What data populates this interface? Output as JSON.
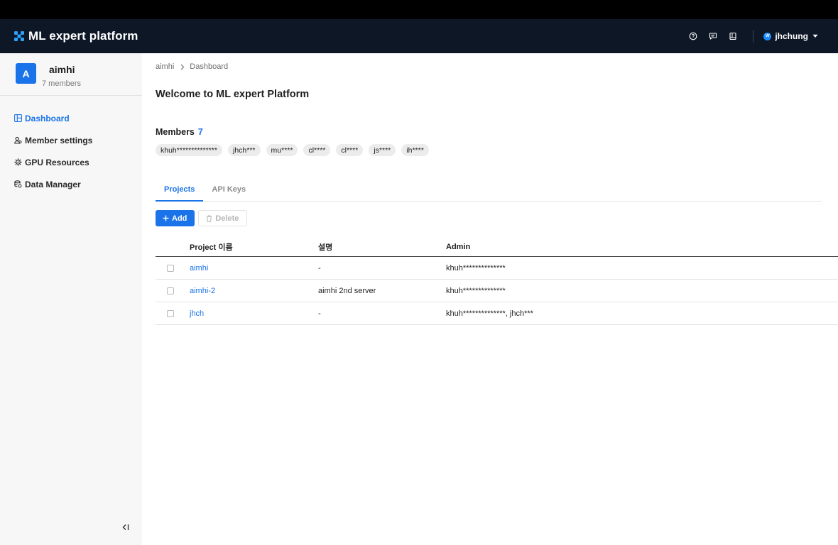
{
  "brand": {
    "title": "ML expert platform",
    "accent": "#2aa3ff"
  },
  "topnav": {
    "icons": [
      "help-icon",
      "chat-icon",
      "book-icon"
    ],
    "user": {
      "avatar_letter": "W",
      "name": "jhchung"
    }
  },
  "sidebar": {
    "org": {
      "avatar_letter": "A",
      "name": "aimhi",
      "members": "7 members"
    },
    "items": [
      {
        "label": "Dashboard",
        "icon": "dashboard-icon",
        "active": true
      },
      {
        "label": "Member settings",
        "icon": "members-icon",
        "active": false
      },
      {
        "label": "GPU Resources",
        "icon": "gpu-icon",
        "active": false
      },
      {
        "label": "Data Manager",
        "icon": "database-icon",
        "active": false
      }
    ]
  },
  "breadcrumb": {
    "root": "aimhi",
    "current": "Dashboard"
  },
  "page_title": "Welcome to ML expert Platform",
  "members": {
    "label": "Members",
    "count": "7",
    "chips": [
      "khuh**************",
      "jhch***",
      "mu****",
      "cl****",
      "cl****",
      "js****",
      "ih****"
    ]
  },
  "tabs": [
    {
      "label": "Projects",
      "active": true
    },
    {
      "label": "API Keys",
      "active": false
    }
  ],
  "toolbar": {
    "add_label": "Add",
    "delete_label": "Delete"
  },
  "table": {
    "headers": {
      "name": "Project 이름",
      "desc": "설명",
      "admin": "Admin"
    },
    "rows": [
      {
        "name": "aimhi",
        "desc": "-",
        "admin": "khuh**************"
      },
      {
        "name": "aimhi-2",
        "desc": "aimhi 2nd server",
        "admin": "khuh**************"
      },
      {
        "name": "jhch",
        "desc": "-",
        "admin": "khuh**************, jhch***"
      }
    ]
  },
  "colors": {
    "primary": "#1a73e8",
    "nav_bg": "#0e1726",
    "sidebar_bg": "#f7f7f7"
  }
}
